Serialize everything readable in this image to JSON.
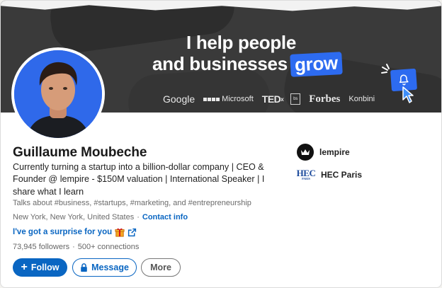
{
  "banner": {
    "headline_line1": "I help people",
    "headline_line2": "and businesses",
    "headline_highlight": "grow",
    "logos": {
      "google": "Google",
      "microsoft": "Microsoft",
      "ted": "TED",
      "ted_sup": "x",
      "business_school": "bs",
      "forbes": "Forbes",
      "konbini": "Konbini"
    },
    "accent_color": "#2d6bf0",
    "icons": [
      "bell-icon",
      "cursor-icon"
    ]
  },
  "profile": {
    "name": "Guillaume Moubeche",
    "bio": "Currently turning a startup into a billion-dollar company | CEO & Founder @ lempire - $150M valuation | International Speaker | I share what I learn",
    "talks_about": "Talks about #business, #startups, #marketing, and #entrepreneurship",
    "location": "New York, New York, United States",
    "location_separator": "·",
    "contact_info": "Contact info",
    "surprise": "I've got a surprise for you",
    "followers": "73,945 followers",
    "separator": "·",
    "connections": "500+ connections"
  },
  "experience": [
    {
      "name": "lempire",
      "icon": "lempire-logo"
    },
    {
      "name": "HEC Paris",
      "icon": "hec-logo",
      "logo_text": "HEC",
      "logo_subtext": "PARIS"
    }
  ],
  "actions": {
    "follow": "Follow",
    "follow_prefix": "+",
    "message": "Message",
    "more": "More"
  },
  "colors": {
    "link": "#0a66c2",
    "banner_bg": "#3a3a3a",
    "avatar_bg": "#2f69ea"
  }
}
